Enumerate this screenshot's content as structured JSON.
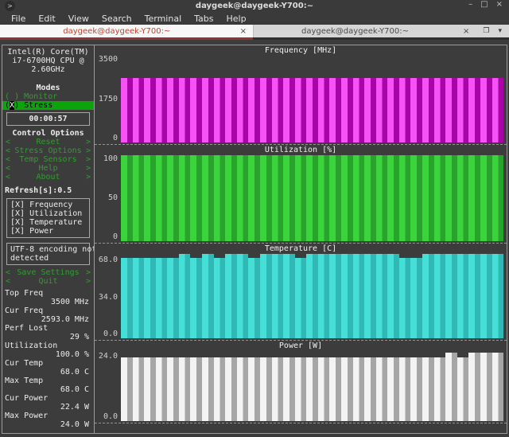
{
  "window": {
    "title": "daygeek@daygeek-Y700:~",
    "controls": {
      "minimize": "–",
      "maximize": "□",
      "close": "×"
    }
  },
  "menu": {
    "items": [
      "File",
      "Edit",
      "View",
      "Search",
      "Terminal",
      "Tabs",
      "Help"
    ]
  },
  "tabs": {
    "active": {
      "label": "daygeek@daygeek-Y700:~",
      "close": "×"
    },
    "inactive": {
      "label": "daygeek@daygeek-Y700:~",
      "close": "×"
    },
    "actions": [
      {
        "name": "open-tab-in-window-icon",
        "glyph": "❐"
      },
      {
        "name": "tab-list-dropdown-icon",
        "glyph": "▾"
      }
    ]
  },
  "sidebar": {
    "cpu_model_lines": [
      "Intel(R) Core(TM)",
      "i7-6700HQ CPU @",
      "2.60GHz"
    ],
    "modes_heading": "Modes",
    "modes": [
      {
        "open": "(",
        "mark": " ",
        "close": ")",
        "label": "Monitor",
        "selected": false
      },
      {
        "open": "(",
        "mark": "X",
        "close": ")",
        "label": "Stress",
        "selected": true
      }
    ],
    "timer": "00:00:57",
    "control_heading": "Control Options",
    "control_arrows": {
      "left": "<",
      "right": ">"
    },
    "control_options": [
      "Reset",
      "Stress Options",
      "Temp Sensors",
      "Help",
      "About"
    ],
    "refresh": "Refresh[s]:0.5",
    "summaries": [
      "[X] Frequency",
      "[X] Utilization",
      "[X] Temperature",
      "[X] Power"
    ],
    "encoding_notice_lines": [
      "UTF-8 encoding not",
      "detected"
    ],
    "actions": [
      "Save Settings",
      "Quit"
    ],
    "stats": [
      {
        "label": "Top Freq",
        "value": "3500 MHz"
      },
      {
        "label": "Cur Freq",
        "value": "2593.0 MHz"
      },
      {
        "label": "Perf Lost",
        "value": "29 %"
      },
      {
        "label": "Utilization",
        "value": "100.0 %"
      },
      {
        "label": "Cur Temp",
        "value": "68.0 C"
      },
      {
        "label": "Max Temp",
        "value": "68.0 C"
      },
      {
        "label": "Cur Power",
        "value": "22.4 W"
      },
      {
        "label": "Max Power",
        "value": "24.0 W"
      }
    ]
  },
  "chart_data": [
    {
      "id": "frequency",
      "type": "bar",
      "title": "Frequency [MHz]",
      "ylim": [
        0,
        3500
      ],
      "scale_max": 3500,
      "tick_values": [
        3500,
        1750,
        0
      ],
      "tick_labels": [
        "3500",
        "1750",
        "0"
      ],
      "colors": {
        "bright": "#f652f6",
        "dark": "#a805a8"
      },
      "values": [
        2593,
        2593,
        2593,
        2593,
        2593,
        2593,
        2593,
        2593,
        2593,
        2593,
        2593,
        2593,
        2593,
        2593,
        2593,
        2593,
        2593,
        2593,
        2593,
        2593,
        2593,
        2593,
        2593,
        2593,
        2593,
        2593,
        2593,
        2593,
        2593,
        2593,
        2593,
        2593,
        2593
      ]
    },
    {
      "id": "utilization",
      "type": "bar",
      "title": "Utilization [%]",
      "ylim": [
        0,
        100
      ],
      "scale_max": 100,
      "tick_values": [
        100,
        50,
        0
      ],
      "tick_labels": [
        "100",
        "50",
        "0"
      ],
      "colors": {
        "bright": "#3cd43c",
        "dark": "#2aa32c"
      },
      "values": [
        100,
        100,
        100,
        100,
        100,
        100,
        100,
        100,
        100,
        100,
        100,
        100,
        100,
        100,
        100,
        100,
        100,
        100,
        100,
        100,
        100,
        100,
        100,
        100,
        100,
        100,
        100,
        100,
        100,
        100,
        100,
        100,
        100
      ]
    },
    {
      "id": "temperature",
      "type": "bar",
      "title": "Temperature [C]",
      "ylim": [
        0,
        68
      ],
      "scale_max": 70,
      "tick_values": [
        68,
        34,
        0
      ],
      "tick_labels": [
        "68.0",
        "34.0",
        "0.0"
      ],
      "colors": {
        "bright": "#45dfd8",
        "dark": "#30b9b4"
      },
      "values": [
        67,
        67,
        67,
        67,
        67,
        70,
        67,
        70,
        67,
        70,
        70,
        67,
        70,
        70,
        70,
        67,
        70,
        70,
        70,
        70,
        70,
        70,
        70,
        70,
        67,
        67,
        70,
        70,
        70,
        70,
        70,
        70,
        70
      ]
    },
    {
      "id": "power",
      "type": "bar",
      "title": "Power [W]",
      "ylim": [
        0,
        24
      ],
      "scale_max": 24.5,
      "tick_values": [
        24,
        0
      ],
      "tick_labels": [
        "24.0",
        "0.0"
      ],
      "colors": {
        "bright": "#f3f3f3",
        "dark": "#a6a6a6"
      },
      "values": [
        22.4,
        22.4,
        22.4,
        22.4,
        22.4,
        22.4,
        22.4,
        22.4,
        22.4,
        22.4,
        22.4,
        22.4,
        22.4,
        22.4,
        22.4,
        22.4,
        22.4,
        22.4,
        22.4,
        22.4,
        22.4,
        22.4,
        22.4,
        22.4,
        22.4,
        22.4,
        22.4,
        22.4,
        24,
        22.4,
        24,
        24,
        24
      ]
    }
  ]
}
